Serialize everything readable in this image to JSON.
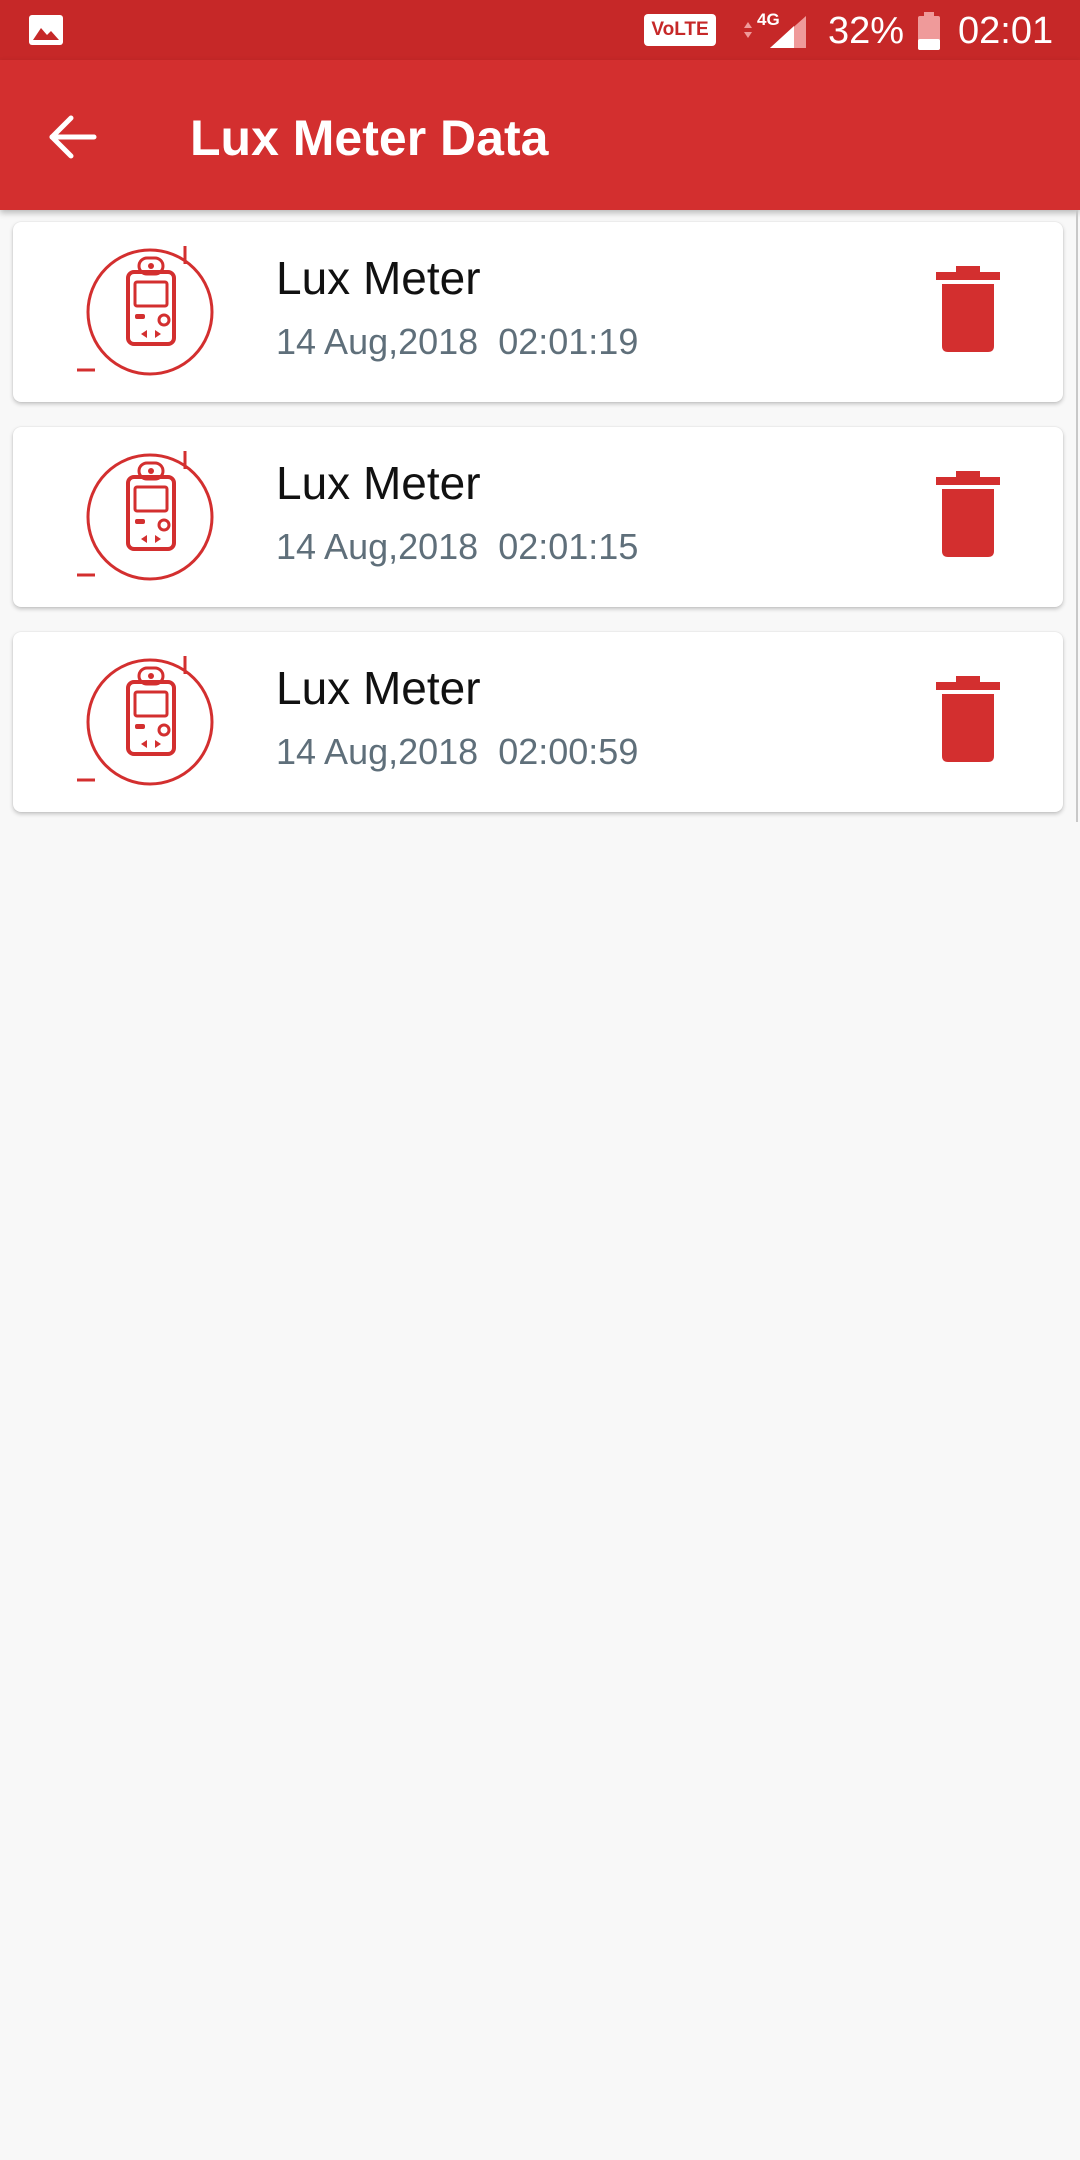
{
  "status_bar": {
    "left_icon": "gallery-icon",
    "volte_label": "VoLTE",
    "network_label": "4G",
    "battery_percent": "32%",
    "battery_level": 0.32,
    "time": "02:01"
  },
  "app_bar": {
    "back_icon": "arrow-left-icon",
    "title": "Lux Meter Data"
  },
  "colors": {
    "primary": "#d32f2f",
    "status_bar": "#c62828",
    "background": "#f8f8f8",
    "card": "#ffffff",
    "icon_red": "#d32f2f",
    "date_text": "#5f6f7a"
  },
  "records": [
    {
      "icon": "lux-meter-device-icon",
      "title": "Lux Meter",
      "date": "14 Aug,2018",
      "time": "02:01:19",
      "action_icon": "trash-icon"
    },
    {
      "icon": "lux-meter-device-icon",
      "title": "Lux Meter",
      "date": "14 Aug,2018",
      "time": "02:01:15",
      "action_icon": "trash-icon"
    },
    {
      "icon": "lux-meter-device-icon",
      "title": "Lux Meter",
      "date": "14 Aug,2018",
      "time": "02:00:59",
      "action_icon": "trash-icon"
    }
  ]
}
